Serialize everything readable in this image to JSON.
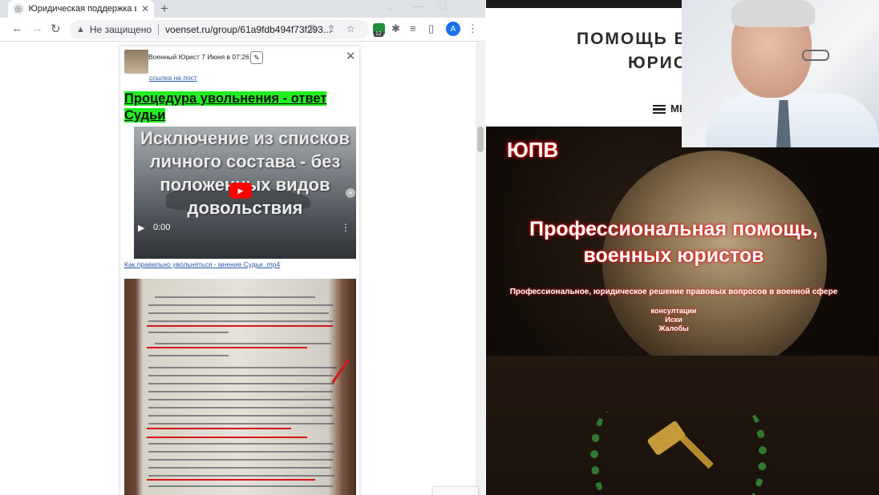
{
  "browser": {
    "tab_title": "Юридическая поддержка военн",
    "tab_favicon": "globe-icon",
    "security_label": "Не защищено",
    "url": "voenset.ru/group/61a9fdb494f73f293...",
    "extension_badge": "12",
    "profile_initial": "A"
  },
  "post": {
    "author_line": "Военный Юрист 7 Июня в 07:26",
    "link_text": "ссылка на пост",
    "title": "Процедура увольнения - ответ Судьи",
    "video": {
      "overlay_text": "Исключение из списков личного состава - без положенных видов довольствия",
      "time": "0:00",
      "caption": "Как правильно увольняться - мнение Судьи .mp4"
    }
  },
  "site": {
    "header_line1": "ПОМОЩЬ В",
    "header_line2": "ЮРИС",
    "menu_label": "МЕ",
    "brand": "ЮПВ",
    "hero_title": "Профессиональная помощь, военных юристов",
    "hero_subtitle": "Профессиональное, юридическое решение правовых вопросов в военной сфере",
    "services": [
      "консултации",
      "Иски",
      "Жалобы"
    ]
  },
  "colors": {
    "highlight": "#22ee22",
    "hero_glow": "#ff0000",
    "link": "#2a5db0"
  }
}
